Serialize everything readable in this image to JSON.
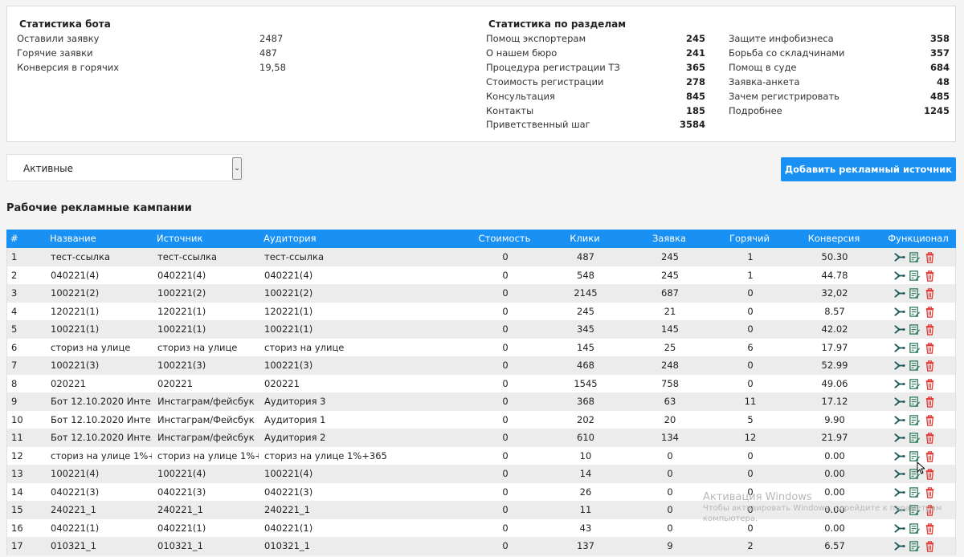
{
  "bot_stats": {
    "title": "Статистика бота",
    "rows": [
      {
        "label": "Оставили заявку",
        "value": "2487"
      },
      {
        "label": "Горячие заявки",
        "value": "487"
      },
      {
        "label": "Конверсия в горячих",
        "value": "19,58"
      }
    ]
  },
  "section_stats": {
    "title": "Статистика по разделам",
    "col1": [
      {
        "label": "Помощ экспортерам",
        "value": "245"
      },
      {
        "label": "О нашем бюро",
        "value": "241"
      },
      {
        "label": "Процедура регистрации ТЗ",
        "value": "365"
      },
      {
        "label": "Стоимость регистрации",
        "value": "278"
      },
      {
        "label": "Консультация",
        "value": "845"
      },
      {
        "label": "Контакты",
        "value": "185"
      },
      {
        "label": "Приветственный шаг",
        "value": "3584"
      }
    ],
    "col2": [
      {
        "label": "Защите инфобизнеса",
        "value": "358"
      },
      {
        "label": "Борьба со складчинами",
        "value": "357"
      },
      {
        "label": "Помощ в суде",
        "value": "684"
      },
      {
        "label": "Заявка-анкета",
        "value": "48"
      },
      {
        "label": "Зачем регистрировать",
        "value": "485"
      },
      {
        "label": "Подробнее",
        "value": "1245"
      }
    ]
  },
  "filter": {
    "selected": "Активные"
  },
  "add_button_label": "Добавить рекламный источник",
  "campaigns_title": "Рабочие рекламные кампании",
  "table": {
    "headers": {
      "num": "#",
      "name": "Название",
      "source": "Источник",
      "audience": "Аудитория",
      "cost": "Стоимость",
      "clicks": "Клики",
      "leads": "Заявка",
      "hot": "Горячий",
      "conversion": "Конверсия",
      "functions": "Функционал"
    },
    "rows": [
      {
        "num": "1",
        "name": "тест-ссылка",
        "source": "тест-ссылка",
        "audience": "тест-ссылка",
        "cost": "0",
        "clicks": "487",
        "leads": "245",
        "hot": "1",
        "conversion": "50.30"
      },
      {
        "num": "2",
        "name": "040221(4)",
        "source": "040221(4)",
        "audience": "040221(4)",
        "cost": "0",
        "clicks": "548",
        "leads": "245",
        "hot": "1",
        "conversion": "44.78"
      },
      {
        "num": "3",
        "name": "100221(2)",
        "source": "100221(2)",
        "audience": "100221(2)",
        "cost": "0",
        "clicks": "2145",
        "leads": "687",
        "hot": "0",
        "conversion": "32,02"
      },
      {
        "num": "4",
        "name": "120221(1)",
        "source": "120221(1)",
        "audience": "120221(1)",
        "cost": "0",
        "clicks": "245",
        "leads": "21",
        "hot": "0",
        "conversion": "8.57"
      },
      {
        "num": "5",
        "name": "100221(1)",
        "source": "100221(1)",
        "audience": "100221(1)",
        "cost": "0",
        "clicks": "345",
        "leads": "145",
        "hot": "0",
        "conversion": "42.02"
      },
      {
        "num": "6",
        "name": "сториз на улице",
        "source": "сториз на улице",
        "audience": "сториз на улице",
        "cost": "0",
        "clicks": "145",
        "leads": "25",
        "hot": "6",
        "conversion": "17.97"
      },
      {
        "num": "7",
        "name": "100221(3)",
        "source": "100221(3)",
        "audience": "100221(3)",
        "cost": "0",
        "clicks": "468",
        "leads": "248",
        "hot": "0",
        "conversion": "52.99"
      },
      {
        "num": "8",
        "name": "020221",
        "source": "020221",
        "audience": "020221",
        "cost": "0",
        "clicks": "1545",
        "leads": "758",
        "hot": "0",
        "conversion": "49.06"
      },
      {
        "num": "9",
        "name": "Бот 12.10.2020 Инте...",
        "source": "Инстаграм/фейсбук",
        "audience": "Аудитория 3",
        "cost": "0",
        "clicks": "368",
        "leads": "63",
        "hot": "11",
        "conversion": "17.12"
      },
      {
        "num": "10",
        "name": "Бот 12.10.2020 Инте...",
        "source": "Инстаграм/Фейсбук",
        "audience": "Аудитория 1",
        "cost": "0",
        "clicks": "202",
        "leads": "20",
        "hot": "5",
        "conversion": "9.90"
      },
      {
        "num": "11",
        "name": "Бот 12.10.2020 Инте...",
        "source": "Инстаграм/фейсбук",
        "audience": "Аудитория 2",
        "cost": "0",
        "clicks": "610",
        "leads": "134",
        "hot": "12",
        "conversion": "21.97"
      },
      {
        "num": "12",
        "name": "сториз на улице 1%+...",
        "source": "сториз на улице 1%+...",
        "audience": "сториз на улице 1%+365",
        "cost": "0",
        "clicks": "10",
        "leads": "0",
        "hot": "0",
        "conversion": "0.00"
      },
      {
        "num": "13",
        "name": "100221(4)",
        "source": "100221(4)",
        "audience": "100221(4)",
        "cost": "0",
        "clicks": "14",
        "leads": "0",
        "hot": "0",
        "conversion": "0.00"
      },
      {
        "num": "14",
        "name": "040221(3)",
        "source": "040221(3)",
        "audience": "040221(3)",
        "cost": "0",
        "clicks": "26",
        "leads": "0",
        "hot": "0",
        "conversion": "0.00"
      },
      {
        "num": "15",
        "name": "240221_1",
        "source": "240221_1",
        "audience": "240221_1",
        "cost": "0",
        "clicks": "11",
        "leads": "0",
        "hot": "0",
        "conversion": "0.00"
      },
      {
        "num": "16",
        "name": "040221(1)",
        "source": "040221(1)",
        "audience": "040221(1)",
        "cost": "0",
        "clicks": "43",
        "leads": "0",
        "hot": "0",
        "conversion": "0.00"
      },
      {
        "num": "17",
        "name": "010321_1",
        "source": "010321_1",
        "audience": "010321_1",
        "cost": "0",
        "clicks": "137",
        "leads": "9",
        "hot": "2",
        "conversion": "6.57"
      }
    ]
  },
  "row_action_icons": [
    "share-icon",
    "edit-icon",
    "trash-icon"
  ],
  "colors": {
    "accent": "#1990f4",
    "icon_dark": "#1a5a5a",
    "icon_green": "#2e7d5b",
    "icon_red": "#e53935"
  },
  "watermark": {
    "title": "Активация Windows",
    "text": "Чтобы активировать Windows, перейдите к параметрам компьютера."
  }
}
